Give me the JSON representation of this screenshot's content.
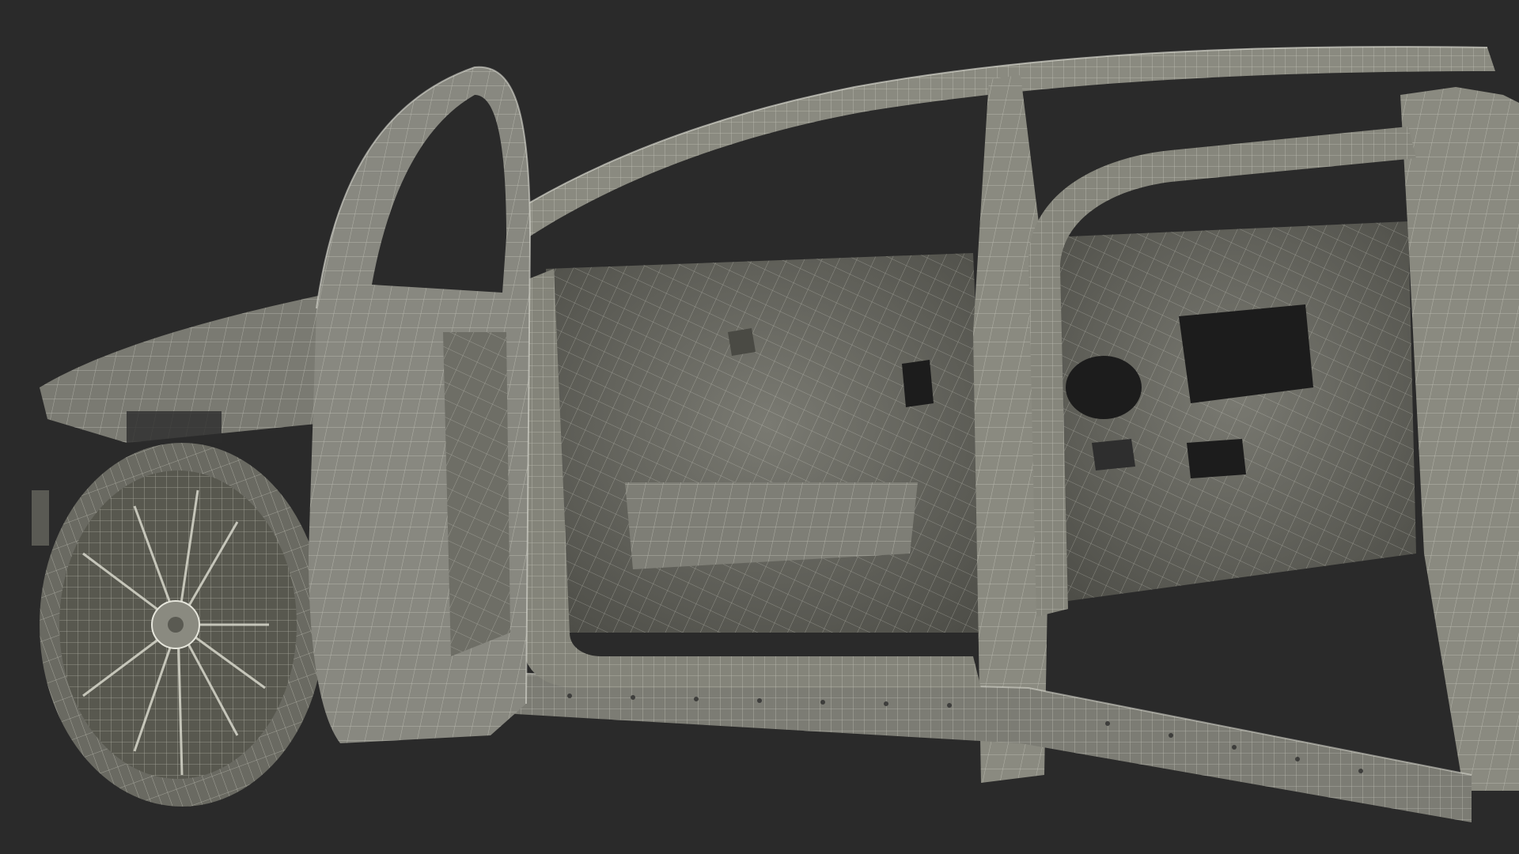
{
  "scene": {
    "subject_icon": "car-body-wireframe-icon",
    "colors": {
      "background": "#2a2a2a",
      "surface_light": "#8e8e84",
      "surface_mid": "#6e6e66",
      "surface_dark": "#4a4a44",
      "wire": "#e6e6dc",
      "window": "#1c1c1c"
    }
  }
}
